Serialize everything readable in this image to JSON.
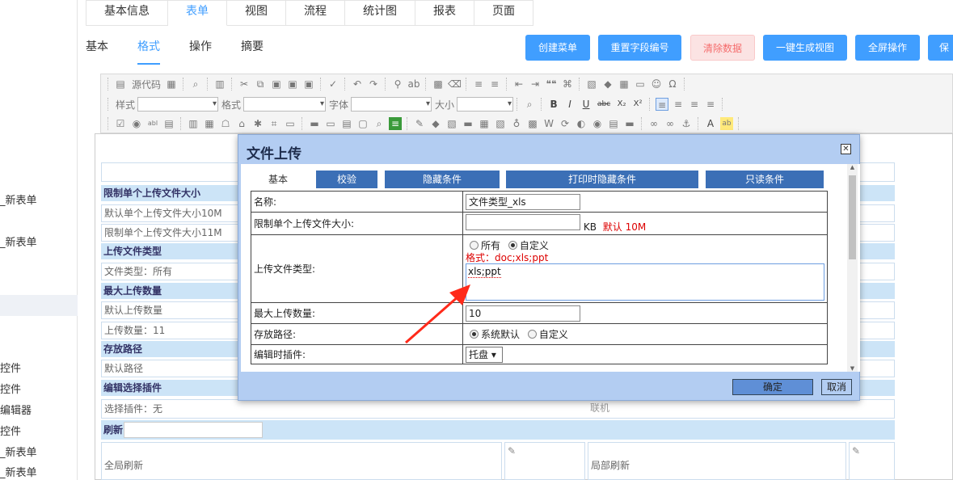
{
  "sidebar": {
    "items": [
      "_新表单",
      "",
      "_新表单",
      "",
      "",
      "",
      "控件",
      "控件",
      "编辑器",
      "控件",
      "_新表单",
      "_新表单"
    ]
  },
  "main_tabs": [
    "基本信息",
    "表单",
    "视图",
    "流程",
    "统计图",
    "报表",
    "页面"
  ],
  "main_tab_active": "表单",
  "sub_tabs": [
    "基本",
    "格式",
    "操作",
    "摘要"
  ],
  "sub_tab_active": "格式",
  "actions": {
    "create_menu": "创建菜单",
    "reset_field_no": "重置字段编号",
    "clear_data": "清除数据",
    "gen_view": "一键生成视图",
    "fullscreen": "全屏操作",
    "save": "保"
  },
  "toolbar": {
    "source": "源代码",
    "style_label": "样式",
    "format_label": "格式",
    "font_label": "字体",
    "size_label": "大小",
    "bold": "B",
    "italic": "I",
    "underline": "U",
    "strike": "abc",
    "sub": "X₂",
    "sup": "X²",
    "omega": "Ω",
    "quote": "❝❝"
  },
  "canvas": {
    "rows": [
      {
        "kind": "head",
        "text": "限制单个上传文件大小"
      },
      {
        "kind": "cell",
        "text": "默认单个上传文件大小10M"
      },
      {
        "kind": "cell",
        "text": "限制单个上传文件大小11M"
      },
      {
        "kind": "head",
        "text": "上传文件类型"
      },
      {
        "kind": "cell",
        "text": "文件类型：所有"
      },
      {
        "kind": "head",
        "text": "最大上传数量"
      },
      {
        "kind": "cell",
        "text": "默认上传数量"
      },
      {
        "kind": "cell",
        "text": "上传数量：11"
      },
      {
        "kind": "head",
        "text": "存放路径"
      },
      {
        "kind": "cell",
        "text": "默认路径"
      },
      {
        "kind": "head",
        "text": "编辑选择插件"
      },
      {
        "kind": "cell",
        "text": "选择插件：无"
      }
    ],
    "refresh_label": "刷新",
    "global_refresh": "全局刷新",
    "local_refresh": "局部刷新",
    "linked": "联机"
  },
  "modal": {
    "title": "文件上传",
    "tabs": [
      "基本",
      "校验",
      "隐藏条件",
      "打印时隐藏条件",
      "只读条件"
    ],
    "active_tab": "基本",
    "fields": {
      "name_label": "名称:",
      "name_value": "文件类型_xls",
      "size_label": "限制单个上传文件大小:",
      "size_value": "",
      "size_unit": "KB",
      "size_default": "默认 10M",
      "type_label": "上传文件类型:",
      "type_all": "所有",
      "type_custom": "自定义",
      "type_format_hint": "格式：doc;xls;ppt",
      "type_value": "xls;ppt",
      "max_label": "最大上传数量:",
      "max_value": "10",
      "path_label": "存放路径:",
      "path_default": "系统默认",
      "path_custom": "自定义",
      "plugin_label": "编辑时插件:",
      "plugin_value": "托盘"
    },
    "ok": "确定",
    "cancel": "取消"
  },
  "colors": {
    "accent": "#409eff",
    "modal_bg": "#b3cdf2",
    "tab_bg": "#3b6fb6",
    "hint_red": "#dd0000",
    "arrow": "#ff2a1a"
  }
}
